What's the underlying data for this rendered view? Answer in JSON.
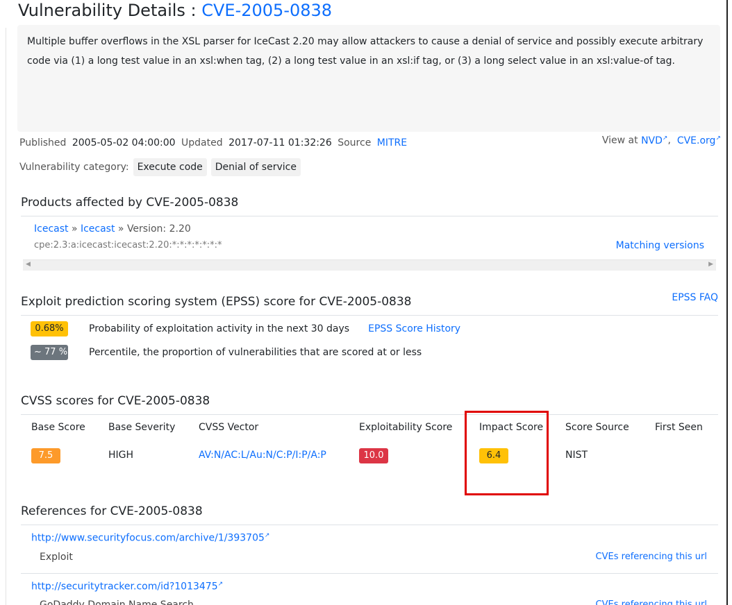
{
  "header": {
    "prefix": "Vulnerability Details : ",
    "cve_id": "CVE-2005-0838"
  },
  "description": "Multiple buffer overflows in the XSL parser for IceCast 2.20 may allow attackers to cause a denial of service and possibly execute arbitrary code via (1) a long test value in an xsl:when tag, (2) a long test value in an xsl:if tag, or (3) a long select value in an xsl:value-of tag.",
  "meta": {
    "published_label": "Published",
    "published": "2005-05-02 04:00:00",
    "updated_label": "Updated",
    "updated": "2017-07-11 01:32:26",
    "source_label": "Source",
    "source": "MITRE",
    "view_at_label": "View at",
    "nvd": "NVD",
    "cve_org": "CVE.org"
  },
  "category": {
    "label": "Vulnerability category:",
    "chips": [
      "Execute code",
      "Denial of service"
    ]
  },
  "products": {
    "heading": "Products affected by CVE-2005-0838",
    "vendor": "Icecast",
    "product": "Icecast",
    "version_label": "Version: 2.20",
    "cpe": "cpe:2.3:a:icecast:icecast:2.20:*:*:*:*:*:*:*",
    "matching": "Matching versions"
  },
  "epss": {
    "heading": "Exploit prediction scoring system (EPSS) score for CVE-2005-0838",
    "faq": "EPSS FAQ",
    "probability_badge": "0.68%",
    "probability_text": "Probability of exploitation activity in the next 30 days",
    "history_link": "EPSS Score History",
    "percentile_badge": "~ 77 %",
    "percentile_text": "Percentile, the proportion of vulnerabilities that are scored at or less"
  },
  "cvss": {
    "heading": "CVSS scores for CVE-2005-0838",
    "headers": [
      "Base Score",
      "Base Severity",
      "CVSS Vector",
      "Exploitability Score",
      "Impact Score",
      "Score Source",
      "First Seen"
    ],
    "row": {
      "base_score": "7.5",
      "severity": "HIGH",
      "vector": "AV:N/AC:L/Au:N/C:P/I:P/A:P",
      "exploitability": "10.0",
      "impact": "6.4",
      "source": "NIST"
    },
    "colors": {
      "base": "#fd9a2a",
      "exploitability": "#dc3545",
      "impact": "#ffc107",
      "highlight_box": "#e00000"
    }
  },
  "references": {
    "heading": "References for CVE-2005-0838",
    "items": [
      {
        "url": "http://www.securityfocus.com/archive/1/393705",
        "type": "Exploit",
        "cves": "CVEs referencing this url"
      },
      {
        "url": "http://securitytracker.com/id?1013475",
        "type": "GoDaddy Domain Name Search",
        "cves": "CVEs referencing this url"
      }
    ]
  }
}
